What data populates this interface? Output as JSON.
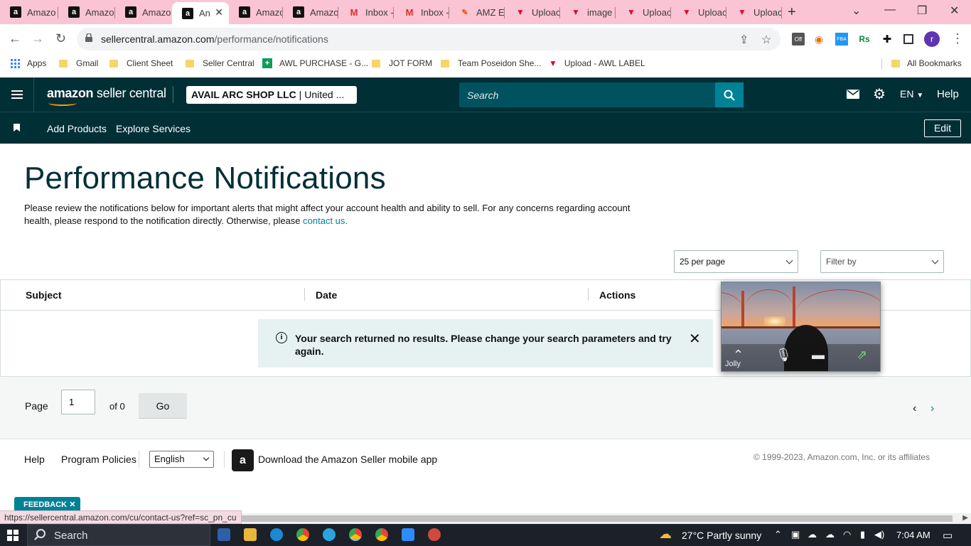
{
  "browser": {
    "tabs": [
      {
        "label": "Amazo",
        "icon": "amazon-favicon",
        "active": false
      },
      {
        "label": "Amazo",
        "icon": "amazon-favicon",
        "active": false
      },
      {
        "label": "Amazo",
        "icon": "amazon-favicon",
        "active": false
      },
      {
        "label": "An",
        "icon": "amazon-favicon",
        "active": true
      },
      {
        "label": "Amazo",
        "icon": "amazon-favicon",
        "active": false
      },
      {
        "label": "Amazo",
        "icon": "amazon-favicon",
        "active": false
      },
      {
        "label": "Inbox -",
        "icon": "gmail-favicon",
        "active": false
      },
      {
        "label": "Inbox -",
        "icon": "gmail-favicon",
        "active": false
      },
      {
        "label": "AMZ E",
        "icon": "pen-favicon",
        "active": false
      },
      {
        "label": "Uploac",
        "icon": "vee-favicon",
        "active": false
      },
      {
        "label": "image",
        "icon": "vee-favicon",
        "active": false
      },
      {
        "label": "Uploac",
        "icon": "vee-favicon",
        "active": false
      },
      {
        "label": "Uploac",
        "icon": "vee-favicon",
        "active": false
      },
      {
        "label": "Uploac",
        "icon": "vee-favicon",
        "active": false
      }
    ],
    "url_host": "sellercentral.amazon.com",
    "url_path": "/performance/notifications",
    "profile_initial": "r",
    "extension_off_badge": "Off",
    "bookmarks": [
      {
        "label": "Apps",
        "icon": "apps-grid-icon"
      },
      {
        "label": "Gmail",
        "icon": "folder-icon"
      },
      {
        "label": "Client Sheet",
        "icon": "folder-icon"
      },
      {
        "label": "Seller Central",
        "icon": "folder-icon"
      },
      {
        "label": "AWL PURCHASE - G...",
        "icon": "sheets-icon"
      },
      {
        "label": "JOT FORM",
        "icon": "folder-icon"
      },
      {
        "label": "Team Poseidon She...",
        "icon": "folder-icon"
      },
      {
        "label": "Upload - AWL LABEL",
        "icon": "vee-icon"
      }
    ],
    "all_bookmarks": "All Bookmarks",
    "status_url": "https://sellercentral.amazon.com/cu/contact-us?ref=sc_pn_cu"
  },
  "header": {
    "logo_bold": "amazon",
    "logo_rest": " seller central",
    "account_name": "AVAIL ARC SHOP LLC",
    "account_region": " | United ...",
    "search_placeholder": "Search",
    "language": "EN",
    "help": "Help",
    "nav_links": [
      "Add Products",
      "Explore Services"
    ],
    "edit": "Edit"
  },
  "main": {
    "title": "Performance Notifications",
    "intro": "Please review the notifications below for important alerts that might affect your account health and ability to sell. For any concerns regarding account health, please respond to the notification directly. Otherwise, please ",
    "intro_link": "contact us.",
    "per_page": "25 per page",
    "filter_placeholder": "Filter by",
    "columns": [
      "Subject",
      "Date",
      "Actions"
    ],
    "alert_message": "Your search returned no results. Please change your search parameters and try again.",
    "pager": {
      "label": "Page",
      "value": "1",
      "of": "of 0",
      "go": "Go"
    }
  },
  "footer": {
    "help": "Help",
    "policies": "Program Policies",
    "language_selected": "English",
    "app_text": "Download the Amazon Seller mobile app",
    "copyright": "© 1999-2023, Amazon.com, Inc. or its affiliates",
    "feedback": "FEEDBACK"
  },
  "video": {
    "name": "Jolly"
  },
  "taskbar": {
    "search": "Search",
    "weather": "27°C  Partly sunny",
    "time": "7:04 AM"
  },
  "colors": {
    "header_bg": "#002f36",
    "accent_teal": "#008296",
    "alert_bg": "#e6f2f2",
    "tabbar_pink": "#fbc4d4"
  }
}
